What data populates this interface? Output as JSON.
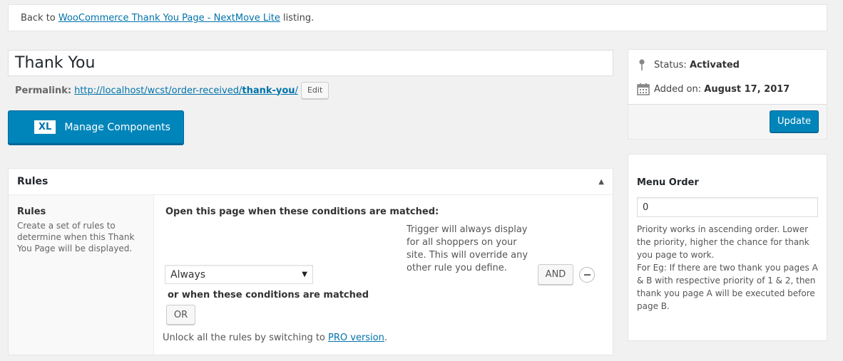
{
  "back_bar": {
    "prefix": "Back to ",
    "link": "WooCommerce Thank You Page - NextMove Lite",
    "suffix": " listing."
  },
  "title": {
    "value": "Thank You"
  },
  "permalink": {
    "label": "Permalink:",
    "url_base": "http://localhost/wcst/order-received/",
    "slug": "thank-you",
    "url_end": "/",
    "edit_label": "Edit"
  },
  "manage": {
    "badge": "XL",
    "label": "Manage Components"
  },
  "rules": {
    "header": "Rules",
    "side_title": "Rules",
    "side_desc": "Create a set of rules to determine when this Thank You Page will be displayed.",
    "conditions_title": "Open this page when these conditions are matched:",
    "select_value": "Always",
    "trigger_text": "Trigger will always display for all shoppers on your site. This will override any other rule you define.",
    "and_label": "AND",
    "or_title": "or when these conditions are matched",
    "or_label": "OR",
    "unlock_prefix": "Unlock all the rules by switching to ",
    "unlock_link": "PRO version",
    "unlock_suffix": "."
  },
  "status": {
    "status_label": "Status:",
    "status_value": "Activated",
    "added_label": "Added on:",
    "added_value": "August 17, 2017",
    "update_label": "Update"
  },
  "menu_order": {
    "title": "Menu Order",
    "value": "0",
    "help1": "Priority works in ascending order. Lower the priority, higher the chance for thank you page to work.",
    "help2": "For Eg: If there are two thank you pages A & B with respective priority of 1 & 2, then thank you page A will be executed before page B."
  },
  "colors": {
    "primary": "#0085ba",
    "link": "#0073aa"
  },
  "icons": {
    "status": "pin-icon",
    "added": "calendar-icon",
    "collapse": "caret-up-icon",
    "remove": "minus-circle-icon",
    "select": "dropdown-arrow-icon"
  }
}
